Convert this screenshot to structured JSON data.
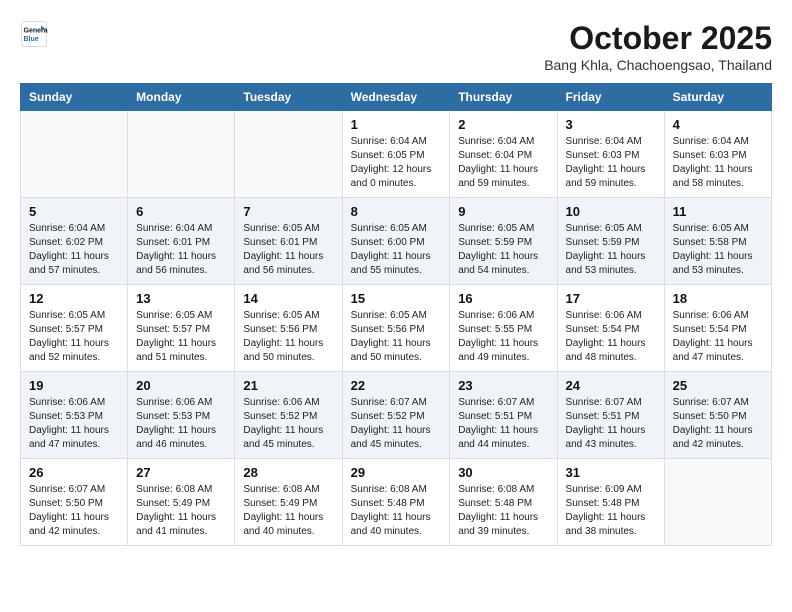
{
  "header": {
    "logo_line1": "General",
    "logo_line2": "Blue",
    "month_year": "October 2025",
    "location": "Bang Khla, Chachoengsao, Thailand"
  },
  "weekdays": [
    "Sunday",
    "Monday",
    "Tuesday",
    "Wednesday",
    "Thursday",
    "Friday",
    "Saturday"
  ],
  "weeks": [
    {
      "days": [
        {
          "num": "",
          "info": ""
        },
        {
          "num": "",
          "info": ""
        },
        {
          "num": "",
          "info": ""
        },
        {
          "num": "1",
          "info": "Sunrise: 6:04 AM\nSunset: 6:05 PM\nDaylight: 12 hours\nand 0 minutes."
        },
        {
          "num": "2",
          "info": "Sunrise: 6:04 AM\nSunset: 6:04 PM\nDaylight: 11 hours\nand 59 minutes."
        },
        {
          "num": "3",
          "info": "Sunrise: 6:04 AM\nSunset: 6:03 PM\nDaylight: 11 hours\nand 59 minutes."
        },
        {
          "num": "4",
          "info": "Sunrise: 6:04 AM\nSunset: 6:03 PM\nDaylight: 11 hours\nand 58 minutes."
        }
      ]
    },
    {
      "days": [
        {
          "num": "5",
          "info": "Sunrise: 6:04 AM\nSunset: 6:02 PM\nDaylight: 11 hours\nand 57 minutes."
        },
        {
          "num": "6",
          "info": "Sunrise: 6:04 AM\nSunset: 6:01 PM\nDaylight: 11 hours\nand 56 minutes."
        },
        {
          "num": "7",
          "info": "Sunrise: 6:05 AM\nSunset: 6:01 PM\nDaylight: 11 hours\nand 56 minutes."
        },
        {
          "num": "8",
          "info": "Sunrise: 6:05 AM\nSunset: 6:00 PM\nDaylight: 11 hours\nand 55 minutes."
        },
        {
          "num": "9",
          "info": "Sunrise: 6:05 AM\nSunset: 5:59 PM\nDaylight: 11 hours\nand 54 minutes."
        },
        {
          "num": "10",
          "info": "Sunrise: 6:05 AM\nSunset: 5:59 PM\nDaylight: 11 hours\nand 53 minutes."
        },
        {
          "num": "11",
          "info": "Sunrise: 6:05 AM\nSunset: 5:58 PM\nDaylight: 11 hours\nand 53 minutes."
        }
      ]
    },
    {
      "days": [
        {
          "num": "12",
          "info": "Sunrise: 6:05 AM\nSunset: 5:57 PM\nDaylight: 11 hours\nand 52 minutes."
        },
        {
          "num": "13",
          "info": "Sunrise: 6:05 AM\nSunset: 5:57 PM\nDaylight: 11 hours\nand 51 minutes."
        },
        {
          "num": "14",
          "info": "Sunrise: 6:05 AM\nSunset: 5:56 PM\nDaylight: 11 hours\nand 50 minutes."
        },
        {
          "num": "15",
          "info": "Sunrise: 6:05 AM\nSunset: 5:56 PM\nDaylight: 11 hours\nand 50 minutes."
        },
        {
          "num": "16",
          "info": "Sunrise: 6:06 AM\nSunset: 5:55 PM\nDaylight: 11 hours\nand 49 minutes."
        },
        {
          "num": "17",
          "info": "Sunrise: 6:06 AM\nSunset: 5:54 PM\nDaylight: 11 hours\nand 48 minutes."
        },
        {
          "num": "18",
          "info": "Sunrise: 6:06 AM\nSunset: 5:54 PM\nDaylight: 11 hours\nand 47 minutes."
        }
      ]
    },
    {
      "days": [
        {
          "num": "19",
          "info": "Sunrise: 6:06 AM\nSunset: 5:53 PM\nDaylight: 11 hours\nand 47 minutes."
        },
        {
          "num": "20",
          "info": "Sunrise: 6:06 AM\nSunset: 5:53 PM\nDaylight: 11 hours\nand 46 minutes."
        },
        {
          "num": "21",
          "info": "Sunrise: 6:06 AM\nSunset: 5:52 PM\nDaylight: 11 hours\nand 45 minutes."
        },
        {
          "num": "22",
          "info": "Sunrise: 6:07 AM\nSunset: 5:52 PM\nDaylight: 11 hours\nand 45 minutes."
        },
        {
          "num": "23",
          "info": "Sunrise: 6:07 AM\nSunset: 5:51 PM\nDaylight: 11 hours\nand 44 minutes."
        },
        {
          "num": "24",
          "info": "Sunrise: 6:07 AM\nSunset: 5:51 PM\nDaylight: 11 hours\nand 43 minutes."
        },
        {
          "num": "25",
          "info": "Sunrise: 6:07 AM\nSunset: 5:50 PM\nDaylight: 11 hours\nand 42 minutes."
        }
      ]
    },
    {
      "days": [
        {
          "num": "26",
          "info": "Sunrise: 6:07 AM\nSunset: 5:50 PM\nDaylight: 11 hours\nand 42 minutes."
        },
        {
          "num": "27",
          "info": "Sunrise: 6:08 AM\nSunset: 5:49 PM\nDaylight: 11 hours\nand 41 minutes."
        },
        {
          "num": "28",
          "info": "Sunrise: 6:08 AM\nSunset: 5:49 PM\nDaylight: 11 hours\nand 40 minutes."
        },
        {
          "num": "29",
          "info": "Sunrise: 6:08 AM\nSunset: 5:48 PM\nDaylight: 11 hours\nand 40 minutes."
        },
        {
          "num": "30",
          "info": "Sunrise: 6:08 AM\nSunset: 5:48 PM\nDaylight: 11 hours\nand 39 minutes."
        },
        {
          "num": "31",
          "info": "Sunrise: 6:09 AM\nSunset: 5:48 PM\nDaylight: 11 hours\nand 38 minutes."
        },
        {
          "num": "",
          "info": ""
        }
      ]
    }
  ]
}
